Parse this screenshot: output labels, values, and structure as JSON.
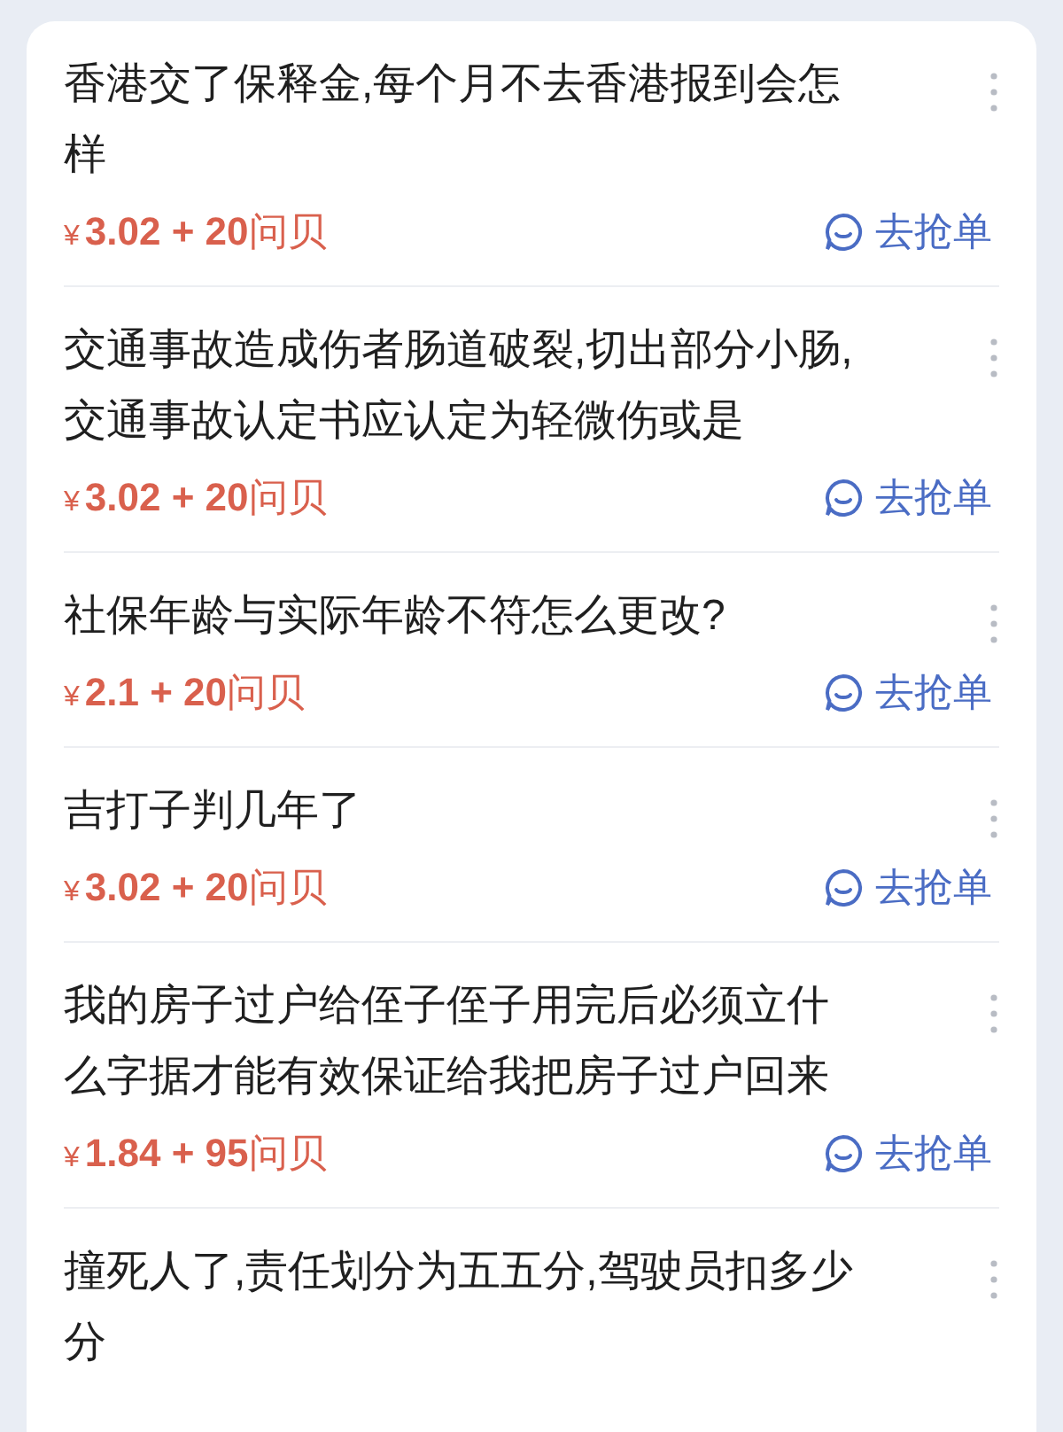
{
  "questions": [
    {
      "title": "香港交了保释金,每个月不去香港报到会怎样",
      "currency": "¥",
      "reward": "3.02 + 20",
      "unit": "问贝",
      "action": "去抢单"
    },
    {
      "title": "交通事故造成伤者肠道破裂,切出部分小肠,交通事故认定书应认定为轻微伤或是",
      "currency": "¥",
      "reward": "3.02 + 20",
      "unit": "问贝",
      "action": "去抢单"
    },
    {
      "title": "社保年龄与实际年龄不符怎么更改?",
      "currency": "¥",
      "reward": "2.1 + 20",
      "unit": "问贝",
      "action": "去抢单"
    },
    {
      "title": "吉打子判几年了",
      "currency": "¥",
      "reward": "3.02 + 20",
      "unit": "问贝",
      "action": "去抢单"
    },
    {
      "title": "我的房子过户给侄子侄子用完后必须立什么字据才能有效保证给我把房子过户回来",
      "currency": "¥",
      "reward": "1.84 + 95",
      "unit": "问贝",
      "action": "去抢单"
    },
    {
      "title": "撞死人了,责任划分为五五分,驾驶员扣多少分"
    }
  ]
}
